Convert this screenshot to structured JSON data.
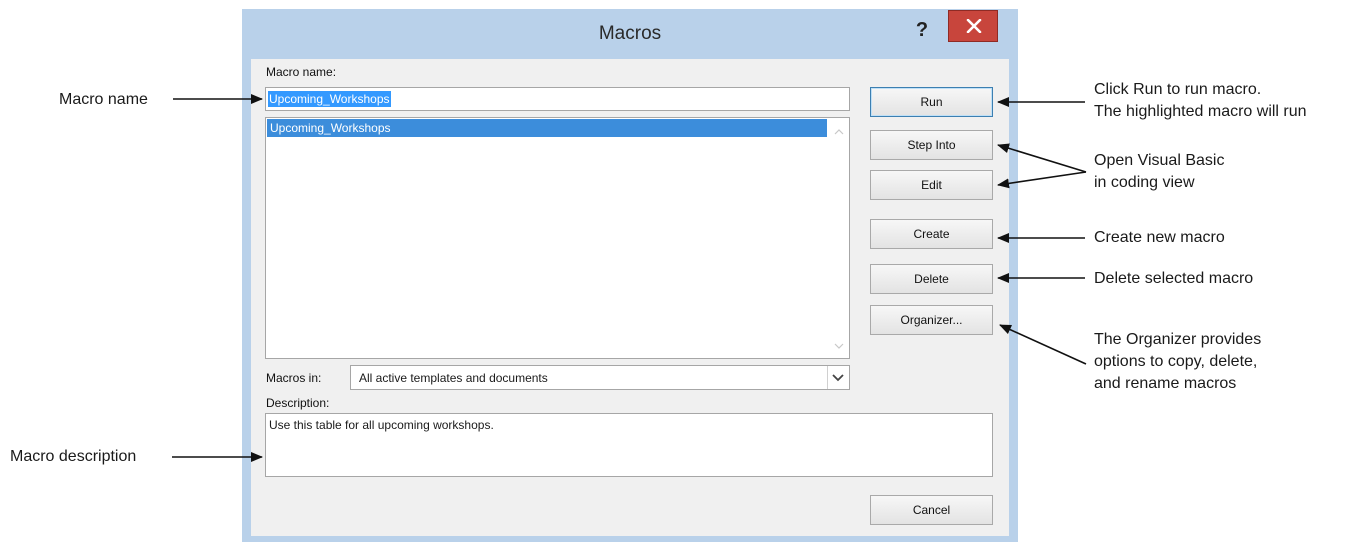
{
  "dialog": {
    "title": "Macros",
    "help_label": "?",
    "macro_name_label": "Macro name:",
    "macro_name_value": "Upcoming_Workshops",
    "macro_list": [
      "Upcoming_Workshops"
    ],
    "macros_in_label": "Macros in:",
    "macros_in_value": "All active templates and documents",
    "description_label": "Description:",
    "description_value": "Use this table for all upcoming workshops.",
    "buttons": {
      "run": "Run",
      "step_into": "Step Into",
      "edit": "Edit",
      "create": "Create",
      "delete": "Delete",
      "organizer": "Organizer...",
      "cancel": "Cancel"
    }
  },
  "annotations": {
    "macro_name": "Macro name",
    "macro_description": "Macro description",
    "run_line1": "Click Run to run macro.",
    "run_line2": "The highlighted macro will run",
    "vb_line1": "Open Visual Basic",
    "vb_line2": "in coding view",
    "create": "Create new macro",
    "delete": "Delete selected macro",
    "organizer_line1": "The Organizer provides",
    "organizer_line2": "options to copy, delete,",
    "organizer_line3": "and rename macros"
  },
  "colors": {
    "frame": "#b9d1ea",
    "close_button": "#c8453c",
    "selection": "#3c8ddb"
  }
}
